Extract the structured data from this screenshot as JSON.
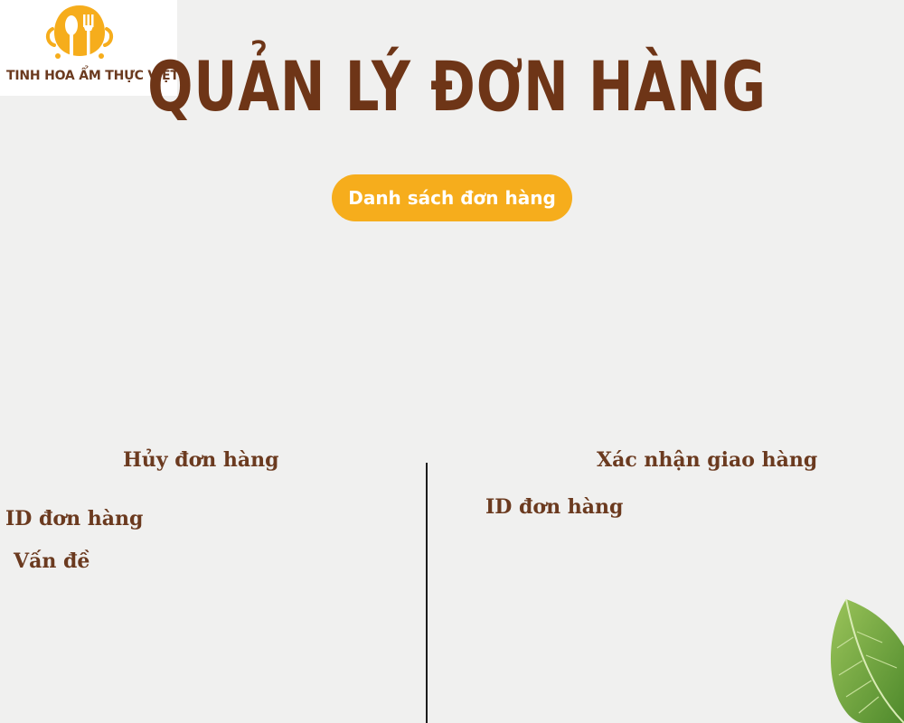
{
  "brand": {
    "name": "TINH HOA ẨM THỰC VIỆT",
    "accent_color": "#f6ad1c",
    "text_color": "#6b3a1f",
    "logo_icon": "spoon-fork-icon"
  },
  "header": {
    "title": "QUẢN LÝ ĐƠN HÀNG"
  },
  "actions": {
    "order_list_label": "Danh sách đơn hàng"
  },
  "cancel_section": {
    "heading": "Hủy đơn hàng",
    "order_id_label": "ID đơn hàng",
    "issue_label": "Vấn đề"
  },
  "confirm_section": {
    "heading": "Xác nhận giao hàng",
    "order_id_label": "ID đơn hàng"
  },
  "decoration": {
    "corner_icon": "leaf-icon"
  }
}
